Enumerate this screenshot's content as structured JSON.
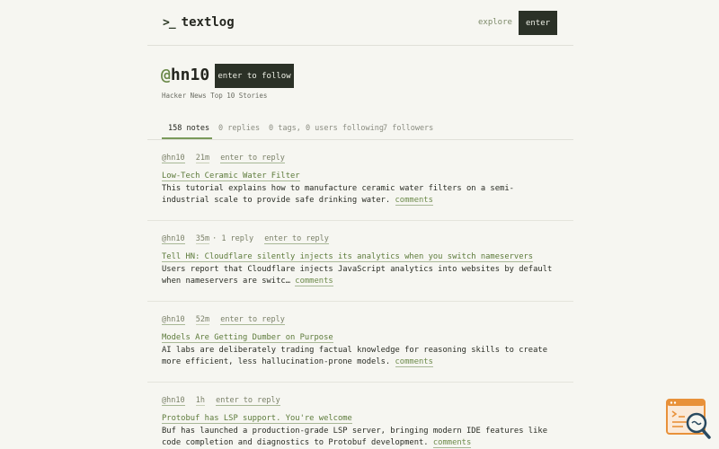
{
  "header": {
    "logo_icon": ">_",
    "logo_text": "textlog",
    "nav_explore": "explore",
    "nav_enter": "enter"
  },
  "profile": {
    "at": "@",
    "name": "hn10",
    "follow_label": "enter to follow",
    "description": "Hacker News Top 10 Stories"
  },
  "tabs": [
    {
      "label": "158 notes",
      "active": true
    },
    {
      "label": "0 replies",
      "active": false
    },
    {
      "label": "0 tags, 0 users following",
      "active": false
    },
    {
      "label": "7 followers",
      "active": false
    }
  ],
  "posts": [
    {
      "user": "@hn10",
      "time": "21m",
      "extra": "",
      "reply": "enter to reply",
      "title": "Low-Tech Ceramic Water Filter",
      "body": "This tutorial explains how to manufacture ceramic water filters on a semi-industrial scale to provide safe drinking water.",
      "comments": "comments"
    },
    {
      "user": "@hn10",
      "time": "35m",
      "extra": "· 1 reply",
      "reply": "enter to reply",
      "title": "Tell HN: Cloudflare silently injects its analytics when you switch nameservers",
      "body": "Users report that Cloudflare injects JavaScript analytics into websites by default when nameservers are switc…",
      "comments": "comments"
    },
    {
      "user": "@hn10",
      "time": "52m",
      "extra": "",
      "reply": "enter to reply",
      "title": "Models Are Getting Dumber on Purpose",
      "body": "AI labs are deliberately trading factual knowledge for reasoning skills to create more efficient, less hallucination-prone models.",
      "comments": "comments"
    },
    {
      "user": "@hn10",
      "time": "1h",
      "extra": "",
      "reply": "enter to reply",
      "title": "Protobuf has LSP support. You're welcome",
      "body": "Buf has launched a production-grade LSP server, bringing modern IDE features like code completion and diagnostics to Protobuf development.",
      "comments": "comments"
    }
  ],
  "colors": {
    "background": "#f6f6f1",
    "accent": "#6c8a4a",
    "dark_button": "#2b3127"
  },
  "widget_icon": "search-document-icon"
}
